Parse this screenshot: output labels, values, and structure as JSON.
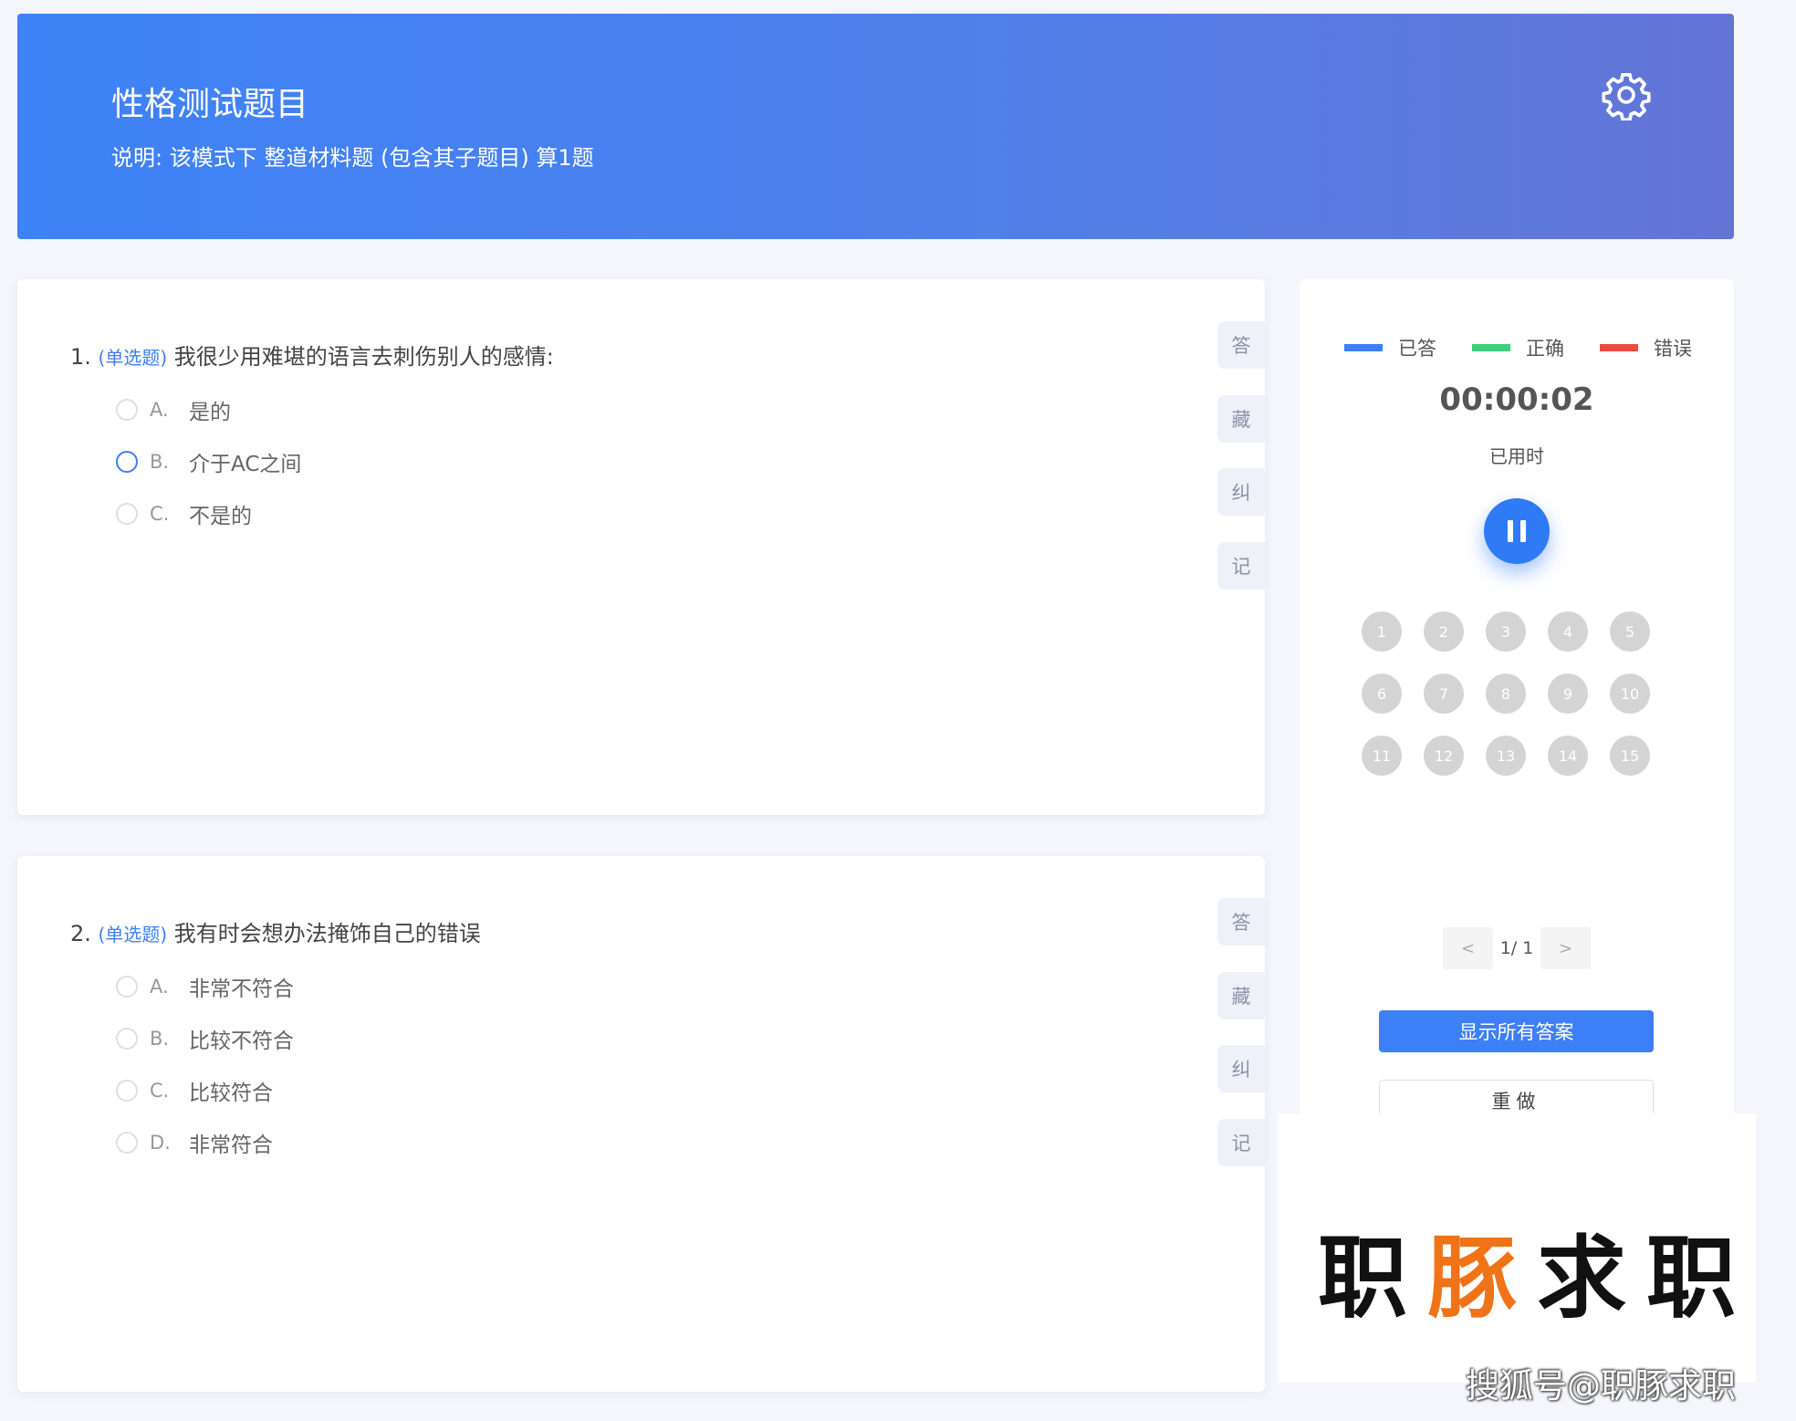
{
  "header": {
    "title": "性格测试题目",
    "description": "说明:  该模式下 整道材料题 (包含其子题目) 算1题"
  },
  "questions": [
    {
      "number": "1.",
      "type": "(单选题)",
      "text": "我很少用难堪的语言去刺伤别人的感情:",
      "options": [
        {
          "letter": "A.",
          "text": "是的"
        },
        {
          "letter": "B.",
          "text": "介于AC之间"
        },
        {
          "letter": "C.",
          "text": "不是的"
        }
      ],
      "side_buttons": [
        "答",
        "藏",
        "纠",
        "记"
      ]
    },
    {
      "number": "2.",
      "type": "(单选题)",
      "text": "我有时会想办法掩饰自己的错误",
      "options": [
        {
          "letter": "A.",
          "text": "非常不符合"
        },
        {
          "letter": "B.",
          "text": "比较不符合"
        },
        {
          "letter": "C.",
          "text": "比较符合"
        },
        {
          "letter": "D.",
          "text": "非常符合"
        }
      ],
      "side_buttons": [
        "答",
        "藏",
        "纠",
        "记"
      ]
    }
  ],
  "panel": {
    "legend": [
      {
        "label": "已答",
        "color": "#3d7ff6"
      },
      {
        "label": "正确",
        "color": "#3ecf7c"
      },
      {
        "label": "错误",
        "color": "#f04a3e"
      }
    ],
    "timer": "00:00:02",
    "timer_label": "已用时",
    "question_numbers": [
      "1",
      "2",
      "3",
      "4",
      "5",
      "6",
      "7",
      "8",
      "9",
      "10",
      "11",
      "12",
      "13",
      "14",
      "15"
    ],
    "pager": {
      "prev": "<",
      "label": "1/ 1",
      "next": ">"
    },
    "show_answers": "显示所有答案",
    "redo": "重做"
  },
  "watermark": {
    "logo_part1": "职",
    "logo_part2": "豚",
    "logo_part3": "求职",
    "sohu": "搜狐号@职豚求职"
  }
}
